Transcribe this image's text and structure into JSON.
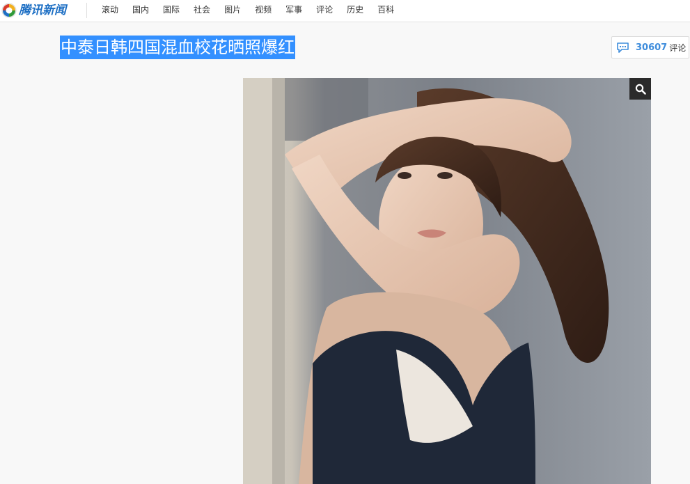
{
  "header": {
    "logo_text": "腾讯新闻",
    "nav": [
      {
        "label": "滚动"
      },
      {
        "label": "国内"
      },
      {
        "label": "国际"
      },
      {
        "label": "社会"
      },
      {
        "label": "图片"
      },
      {
        "label": "视频"
      },
      {
        "label": "军事"
      },
      {
        "label": "评论"
      },
      {
        "label": "历史"
      },
      {
        "label": "百科"
      }
    ]
  },
  "article": {
    "title": "中泰日韩四国混血校花晒照爆红",
    "comment_count": "30607",
    "comment_label": "评论"
  },
  "colors": {
    "brand": "#1d6fc4",
    "selection": "#3390ff",
    "comment_accent": "#3f8ddc"
  },
  "icons": {
    "logo": "tencent-news-logo-icon",
    "comment": "speech-bubble-icon",
    "zoom": "magnifier-icon"
  }
}
